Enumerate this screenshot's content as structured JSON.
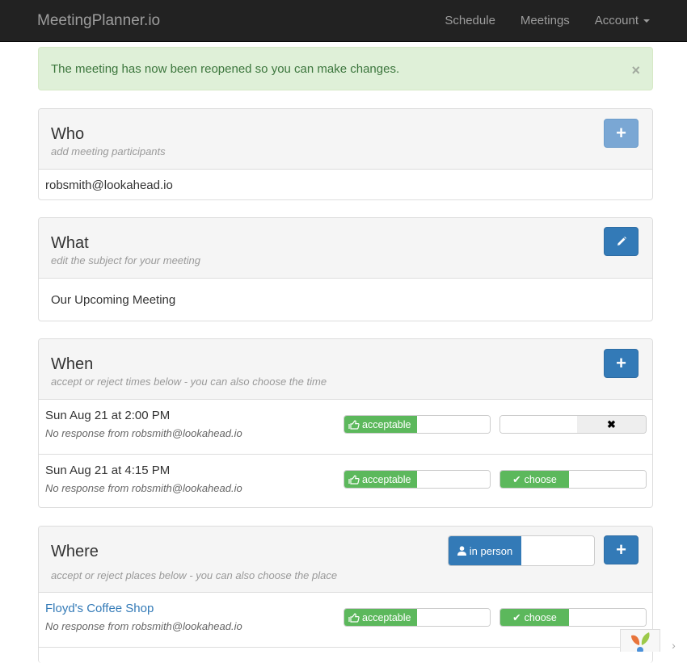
{
  "navbar": {
    "brand": "MeetingPlanner.io",
    "links": [
      {
        "label": "Schedule"
      },
      {
        "label": "Meetings"
      },
      {
        "label": "Account",
        "has_dropdown": true
      }
    ]
  },
  "alert": {
    "message": "The meeting has now been reopened so you can make changes.",
    "close_icon": "×",
    "color": "#3c763d",
    "background": "#dff0d8"
  },
  "who": {
    "title": "Who",
    "subtitle": "add meeting participants",
    "add_icon": "+",
    "participants": [
      "robsmith@lookahead.io"
    ]
  },
  "what": {
    "title": "What",
    "subtitle": "edit the subject for your meeting",
    "edit_icon": "pencil-icon",
    "subject": "Our Upcoming Meeting"
  },
  "when": {
    "title": "When",
    "subtitle": "accept or reject times below - you can also choose the time",
    "add_icon": "+",
    "times": [
      {
        "label": "Sun Aug 21 at 2:00 PM",
        "status": "No response from robsmith@lookahead.io",
        "acceptable_label": "acceptable",
        "choose_label": "",
        "choose_off_icon": "✖",
        "chosen": false
      },
      {
        "label": "Sun Aug 21 at 4:15 PM",
        "status": "No response from robsmith@lookahead.io",
        "acceptable_label": "acceptable",
        "choose_label": "choose",
        "chosen": true
      }
    ]
  },
  "where": {
    "title": "Where",
    "subtitle": "accept or reject places below  - you can also choose the place",
    "in_person_label": "in person",
    "add_icon": "+",
    "places": [
      {
        "name": "Floyd's Coffee Shop",
        "status": "No response from robsmith@lookahead.io",
        "acceptable_label": "acceptable",
        "choose_label": "choose",
        "chosen": true
      }
    ]
  },
  "colors": {
    "navbar": "#222222",
    "primary": "#337ab7",
    "success": "#5cb85c",
    "link": "#337ab7"
  },
  "corner_widget": {
    "arrow": "›"
  }
}
